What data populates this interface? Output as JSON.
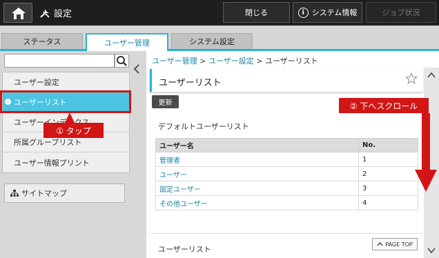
{
  "topbar": {
    "title": "設定",
    "close_label": "閉じる",
    "sysinfo_label": "システム情報",
    "job_label": "ジョブ状況"
  },
  "tabs": [
    {
      "label": "ステータス"
    },
    {
      "label": "ユーザー管理"
    },
    {
      "label": "システム設定"
    }
  ],
  "sidebar": {
    "search_placeholder": "",
    "items": [
      {
        "label": "ユーザー設定"
      },
      {
        "label": "ユーザーリスト"
      },
      {
        "label": "ユーザーインデックス"
      },
      {
        "label": "所属グループリスト"
      },
      {
        "label": "ユーザー情報プリント"
      }
    ],
    "sitemap_label": "サイトマップ"
  },
  "breadcrumb": {
    "item1": "ユーザー管理",
    "item2": "ユーザー設定",
    "current": "ユーザーリスト",
    "sep": ">"
  },
  "main": {
    "title": "ユーザーリスト",
    "refresh_label": "更新",
    "default_section": "デフォルトユーザーリスト",
    "table_headers": {
      "name": "ユーザー名",
      "no": "No."
    },
    "rows": [
      {
        "name": "管理者",
        "no": "1"
      },
      {
        "name": "ユーザー",
        "no": "2"
      },
      {
        "name": "固定ユーザー",
        "no": "3"
      },
      {
        "name": "その他ユーザー",
        "no": "4"
      }
    ],
    "user_section": "ユーザーリスト",
    "pagetop_label": "PAGE TOP"
  },
  "annotations": {
    "tap": "① タップ",
    "scroll": "② 下へスクロール"
  },
  "colors": {
    "accent": "#2bb1d2",
    "active_item": "#4ac4e0",
    "annotation_red": "#d21515"
  }
}
